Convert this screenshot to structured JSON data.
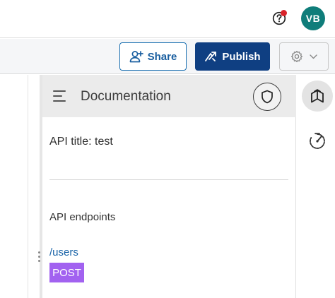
{
  "header": {
    "help_icon": "question-mark-circle-icon",
    "notification_color": "#d8232a",
    "avatar_initials": "VB",
    "avatar_color": "#0f7d7a"
  },
  "toolbar": {
    "share_label": "Share",
    "share_icon": "add-person-icon",
    "publish_label": "Publish",
    "publish_icon": "publish-arrows-icon",
    "publish_color": "#0f3f82",
    "settings_icon": "gear-icon",
    "settings_dropdown_icon": "chevron-down-icon"
  },
  "panel": {
    "menu_icon": "hamburger-menu-icon",
    "title": "Documentation",
    "shield_icon": "shield-icon",
    "api_title": "API title: test",
    "endpoints_heading": "API endpoints",
    "endpoints": [
      {
        "path": "/users",
        "method": "POST",
        "method_color": "#a262f0"
      }
    ]
  },
  "right_rail": {
    "items": [
      {
        "icon": "documentation-book-icon",
        "active": true
      },
      {
        "icon": "speed-gauge-icon",
        "active": false
      }
    ]
  }
}
